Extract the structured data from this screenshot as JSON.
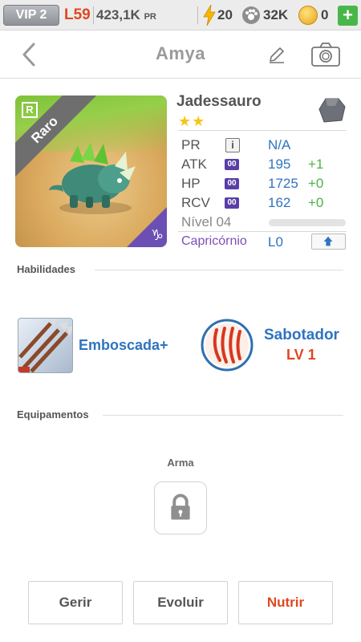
{
  "topbar": {
    "vip": "VIP 2",
    "level": "L59",
    "pr_value": "423,1K",
    "pr_suffix": "PR",
    "energy": "20",
    "paw_value": "32K",
    "coins": "0",
    "plus": "+"
  },
  "header": {
    "title": "Amya"
  },
  "creature": {
    "rarity_badge": "R",
    "rarity": "Raro",
    "zodiac_symbol": "♑",
    "species": "Jadessauro",
    "stars": "★★",
    "stats": {
      "pr_label": "PR",
      "pr_info": "i",
      "pr_value": "N/A",
      "atk_label": "ATK",
      "atk_chip": "00",
      "atk_value": "195",
      "atk_bonus": "+1",
      "hp_label": "HP",
      "hp_chip": "00",
      "hp_value": "1725",
      "hp_bonus": "+0",
      "rcv_label": "RCV",
      "rcv_chip": "00",
      "rcv_value": "162",
      "rcv_bonus": "+0",
      "level_label": "Nível 04",
      "level_progress": 0
    },
    "zodiac_name": "Capricórnio",
    "zodiac_level": "L0"
  },
  "skills": {
    "section_label": "Habilidades",
    "skill1_name": "Emboscada+",
    "skill2_name": "Sabotador",
    "skill2_level": "LV 1"
  },
  "equipment": {
    "section_label": "Equipamentos",
    "weapon_label": "Arma"
  },
  "actions": {
    "manage": "Gerir",
    "evolve": "Evoluir",
    "feed": "Nutrir"
  },
  "colors": {
    "accent_blue": "#2f74c0",
    "accent_orange": "#e0481f",
    "bonus_green": "#4cb341",
    "zodiac_purple": "#7b4fb8"
  }
}
